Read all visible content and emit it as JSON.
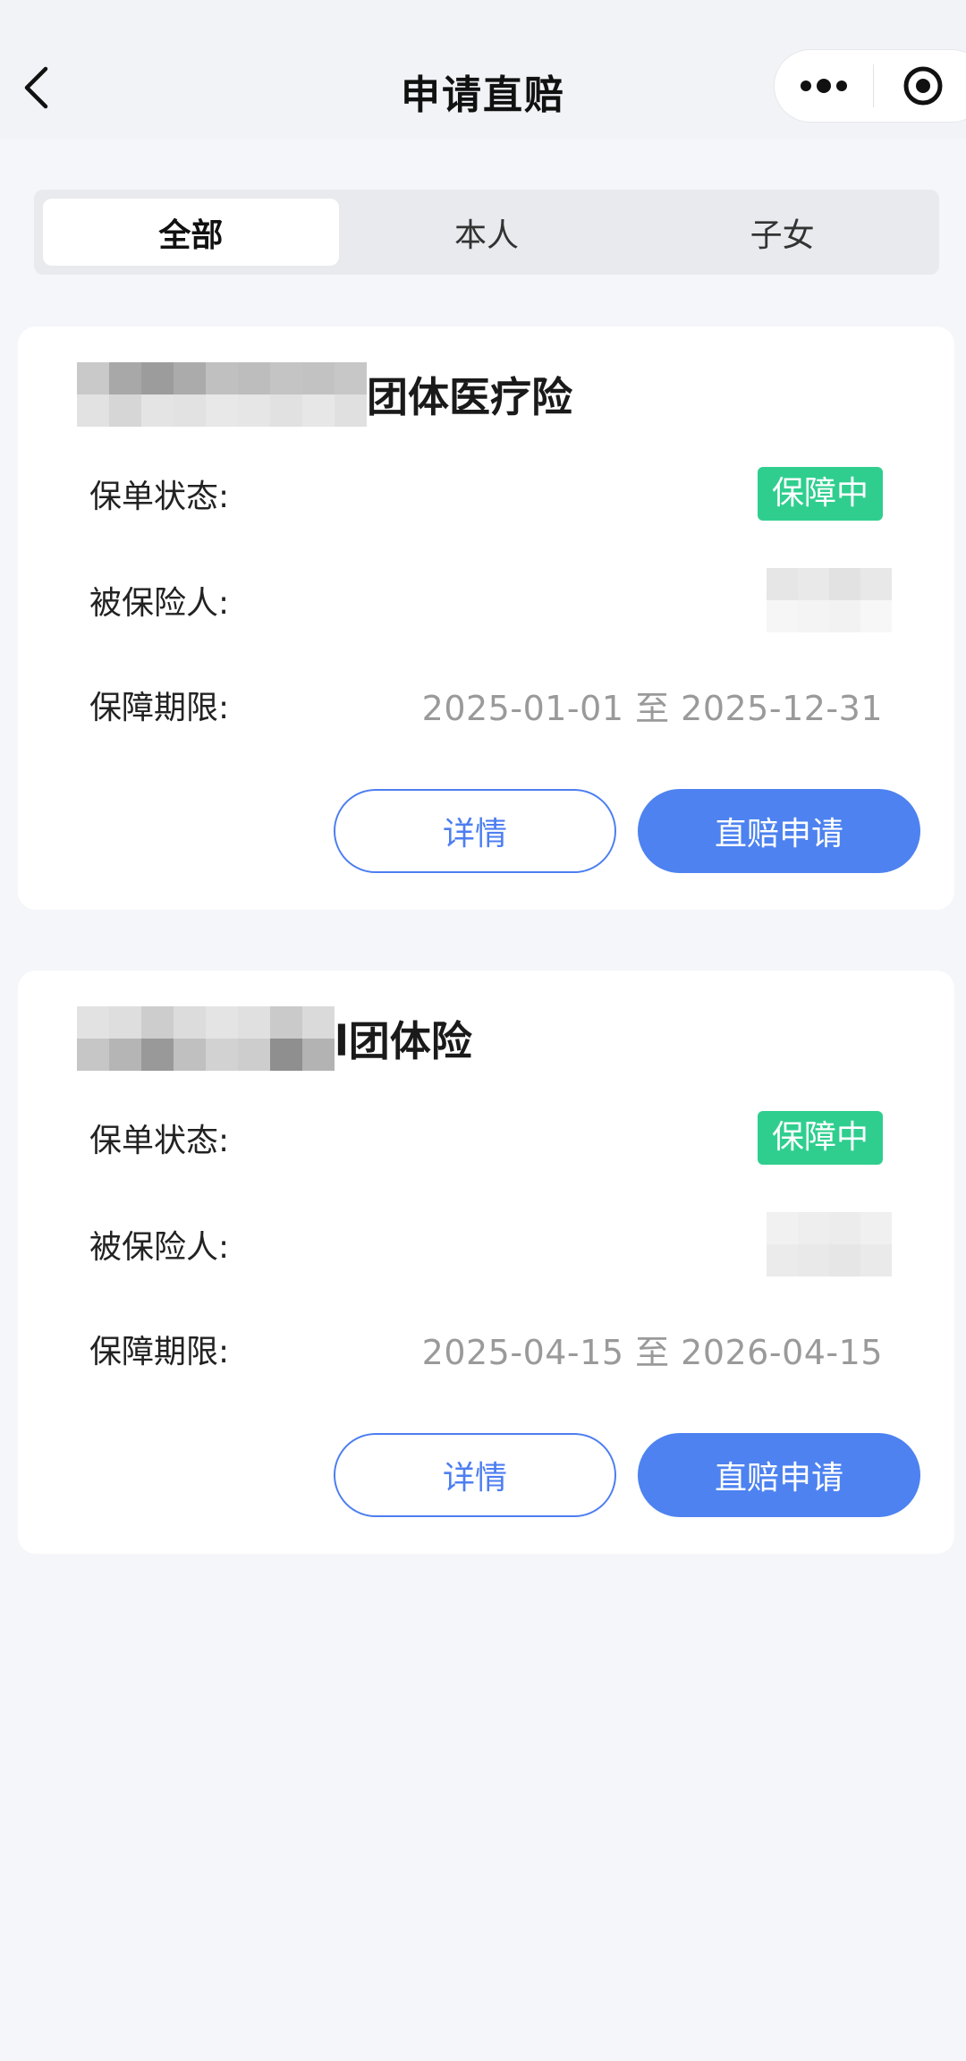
{
  "nav": {
    "title": "申请直赔",
    "icons": {
      "back": "chevron-left-icon",
      "more": "more-dots-icon",
      "close": "target-close-icon"
    }
  },
  "tabs": [
    {
      "label": "全部",
      "active": true
    },
    {
      "label": "本人",
      "active": false
    },
    {
      "label": "子女",
      "active": false
    }
  ],
  "policies": [
    {
      "title_suffix": "团体医疗险",
      "status_label": "保单状态:",
      "status": "保障中",
      "insured_label": "被保险人:",
      "period_label": "保障期限:",
      "period": "2025-01-01 至 2025-12-31",
      "detail_button": "详情",
      "apply_button": "直赔申请"
    },
    {
      "title_suffix": "l团体险",
      "status_label": "保单状态:",
      "status": "保障中",
      "insured_label": "被保险人:",
      "period_label": "保障期限:",
      "period": "2025-04-15 至 2026-04-15",
      "detail_button": "详情",
      "apply_button": "直赔申请"
    }
  ],
  "colors": {
    "primary": "#4d82f0",
    "status_green": "#2fce8f",
    "background": "#f5f6fa"
  }
}
